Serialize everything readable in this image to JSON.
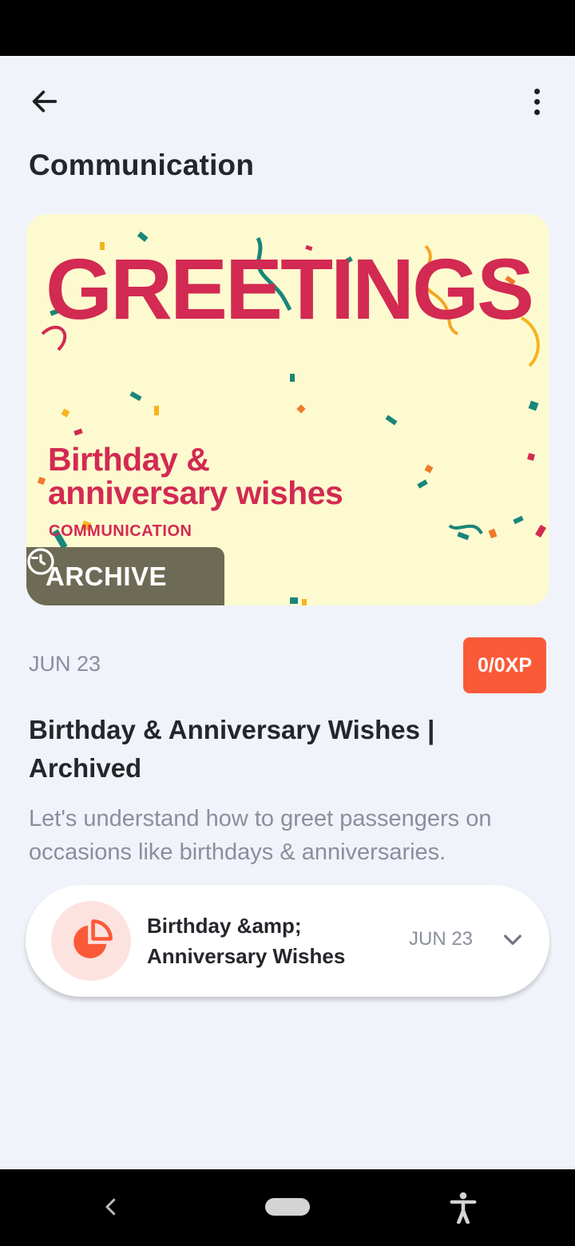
{
  "header": {
    "title": "Communication"
  },
  "banner": {
    "headline": "GREETINGS",
    "subtitle_line1": "Birthday &",
    "subtitle_line2": "anniversary wishes",
    "category": "COMMUNICATION",
    "badge_label": "ARCHIVE",
    "background_color": "#fdfad0",
    "accent_color": "#d22a52"
  },
  "meta": {
    "date": "JUN 23",
    "xp": "0/0XP",
    "xp_color": "#fb5a38"
  },
  "content": {
    "headline": "Birthday & Anniversary Wishes | Archived",
    "description": "Let's understand how to greet passengers on occasions like birthdays & anniversaries."
  },
  "module_item": {
    "icon": "pie-chart-icon",
    "title": "Birthday &amp; Anniversary Wishes",
    "date": "JUN 23"
  },
  "icons": {
    "back": "arrow-left-icon",
    "more": "more-vertical-icon",
    "archive": "history-icon",
    "expand": "chevron-down-icon"
  }
}
